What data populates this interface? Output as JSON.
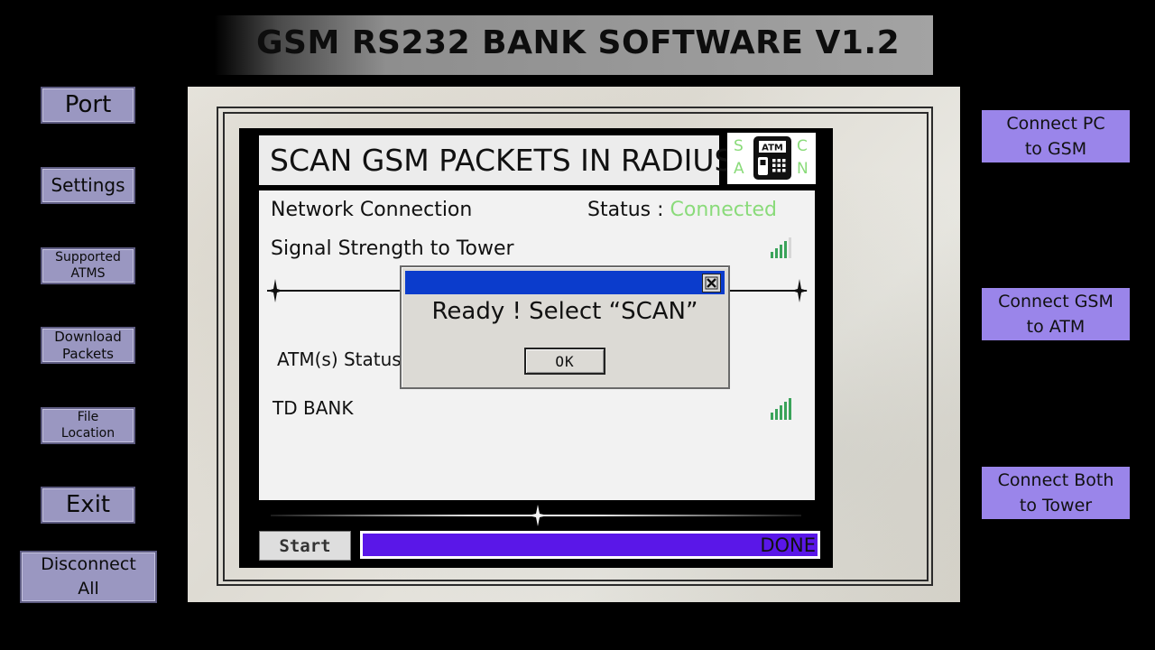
{
  "app": {
    "title": "GSM RS232 BANK SOFTWARE V1.2"
  },
  "left_menu": {
    "port": "Port",
    "settings": "Settings",
    "supported_atms": "Supported ATMS",
    "download_packets": "Download Packets",
    "file_location": "File Location",
    "exit": "Exit",
    "disconnect_all": "Disconnect All"
  },
  "right_menu": {
    "connect_pc_gsm": "Connect PC to GSM",
    "connect_gsm_atm": "Connect GSM to ATM",
    "connect_both_tower": "Connect Both to Tower"
  },
  "panel": {
    "title": "SCAN GSM PACKETS IN RADIUS",
    "logo": {
      "left": [
        "S",
        "A"
      ],
      "right": [
        "C",
        "N"
      ],
      "icon_text": "ATM"
    },
    "network_label": "Network Connection",
    "status_label": "Status : ",
    "status_value": "Connected",
    "signal_label": "Signal Strength to Tower",
    "atm_status_label": "ATM(s) Status",
    "bank_name": "TD BANK",
    "start_button": "Start",
    "progress_text": "DONE",
    "progress": 1.0
  },
  "dialog": {
    "message": "Ready ! Select “SCAN”",
    "ok_label": "OK"
  },
  "colors": {
    "left_button": "#9a97c1",
    "right_button": "#9a85ea",
    "status_connected": "#8adb7a",
    "dialog_titlebar": "#0b3ccc",
    "progress_fill": "#5a17e8",
    "signal_bars": "#3aa35a"
  },
  "icons": {
    "signal": "signal-strength-icon",
    "atm": "atm-machine-icon",
    "close": "close-icon",
    "divider_ornament": "diamond-ornament-icon"
  }
}
